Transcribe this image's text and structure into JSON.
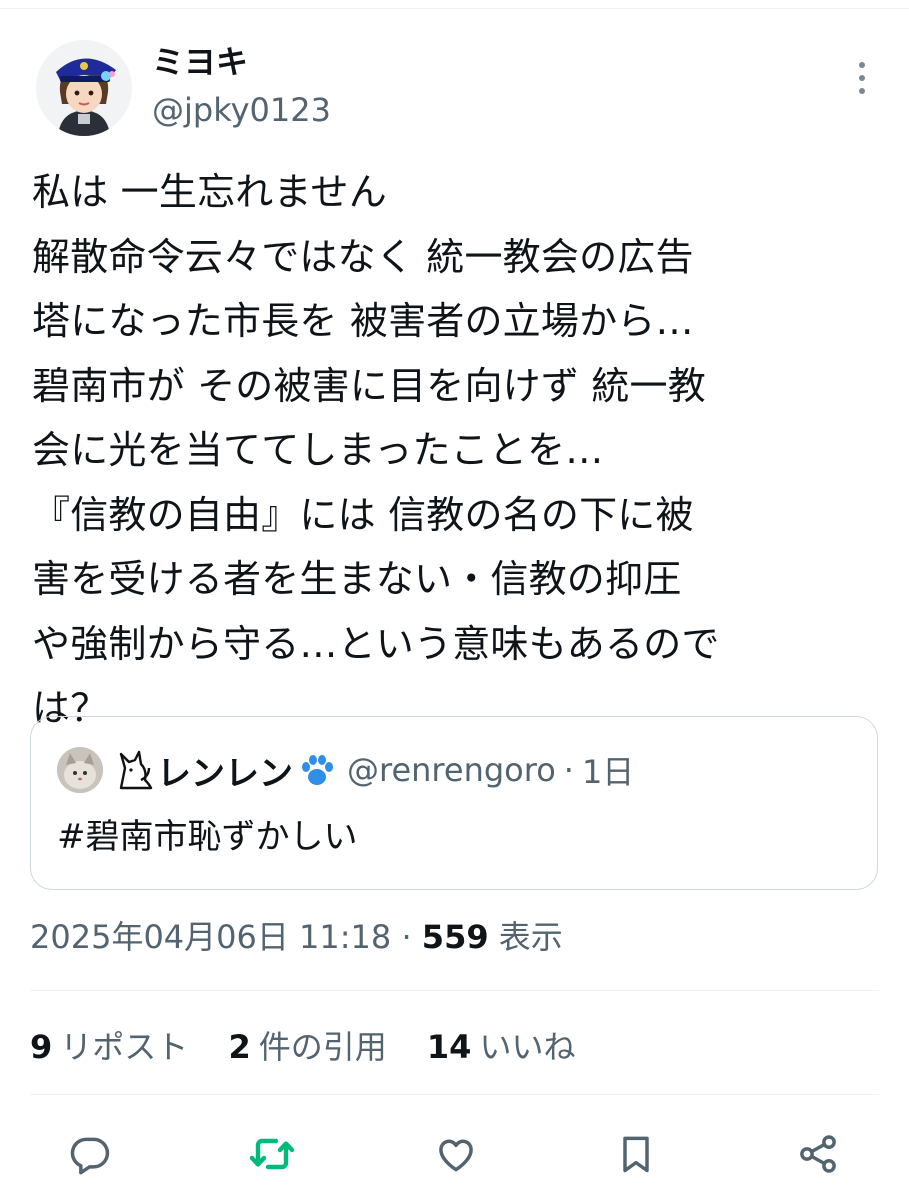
{
  "author": {
    "display_name": "ミヨキ",
    "handle": "@jpky0123",
    "avatar_icon": "user-avatar-icon"
  },
  "tweet": {
    "text": "私は 一生忘れません\n解散命令云々ではなく 統一教会の広告\n塔になった市長を 被害者の立場から…\n碧南市が その被害に目を向けず 統一教\n会に光を当ててしまったことを…\n『信教の自由』には 信教の名の下に被\n害を受ける者を生まない・信教の抑圧\nや強制から守る…という意味もあるので\nは？"
  },
  "quoted": {
    "name": "レンレン",
    "handle": "@renrengoro",
    "separator": "·",
    "time": "1日",
    "text": "#碧南市恥ずかしい"
  },
  "meta": {
    "timestamp": "2025年04月06日 11:18",
    "separator": "·",
    "views_count": "559",
    "views_label": "表示"
  },
  "stats": {
    "reposts_count": "9",
    "reposts_label": "リポスト",
    "quotes_count": "2",
    "quotes_label": "件の引用",
    "likes_count": "14",
    "likes_label": "いいね"
  },
  "colors": {
    "text": "#0f1419",
    "secondary": "#536471",
    "border": "#cfd9de",
    "retweet_green": "#00ba7c"
  },
  "icons": [
    "reply-icon",
    "retweet-icon",
    "like-icon",
    "bookmark-icon",
    "share-icon",
    "more-icon"
  ]
}
